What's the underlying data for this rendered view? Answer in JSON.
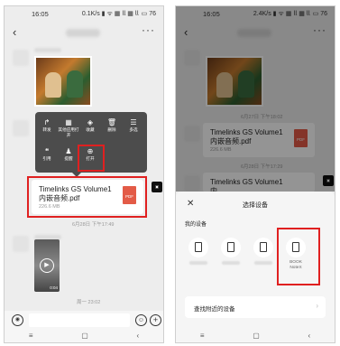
{
  "left": {
    "status": {
      "time": "16:05",
      "network": "0.1K/s ▮ ᯤ ▦ 𝗅𝗅 ▦ 𝗅𝗅",
      "battery": "▭ 76"
    },
    "nav": {
      "back": "‹",
      "more": "···"
    },
    "context_menu": {
      "row1": [
        {
          "icon": "↱",
          "label": "转发"
        },
        {
          "icon": "▦",
          "label": "其他应用打开"
        },
        {
          "icon": "◈",
          "label": "收藏"
        },
        {
          "icon": "🗑",
          "label": "删除"
        },
        {
          "icon": "☰",
          "label": "多选"
        }
      ],
      "row2": [
        {
          "icon": "❝",
          "label": "引用"
        },
        {
          "icon": "♟",
          "label": "提醒"
        },
        {
          "icon": "⊕",
          "label": "打开"
        }
      ]
    },
    "file": {
      "name": "Timelinks GS Volume1 内嵌音频.pdf",
      "size": "226.6 MB",
      "type": "PDF"
    },
    "timestamp1": "6月28日 下午17:49",
    "video": {
      "duration": "0:04"
    },
    "timestamp2": "周一 23:02",
    "input": {
      "voice_icon": "◉",
      "emoji_icon": "☺",
      "plus_icon": "+"
    },
    "sysnav": [
      "≡",
      "▢",
      "‹"
    ]
  },
  "right": {
    "status": {
      "time": "16:05",
      "network": "2.4K/s ▮ ᯤ ▦ 𝗅𝗅 ▦ 𝗅𝗅",
      "battery": "▭ 76"
    },
    "nav": {
      "back": "‹",
      "more": "···"
    },
    "background": {
      "timestamp0": "6月27日 下午18:02",
      "file1": {
        "name": "Timelinks GS Volume1 内嵌音频.pdf",
        "size": "226.6 MB"
      },
      "timestamp1": "6月28日 下午17:29",
      "file2": {
        "name": "Timelinks GS Volume1 内"
      }
    },
    "sheet": {
      "close": "✕",
      "title": "选择设备",
      "my_devices": "我的设备",
      "devices": [
        {
          "label": ""
        },
        {
          "label": ""
        },
        {
          "label": ""
        },
        {
          "label": "BOOK NoteX"
        }
      ],
      "nearby": "查找附近的设备",
      "chevron": "›"
    },
    "sysnav": [
      "≡",
      "▢",
      "‹"
    ]
  }
}
